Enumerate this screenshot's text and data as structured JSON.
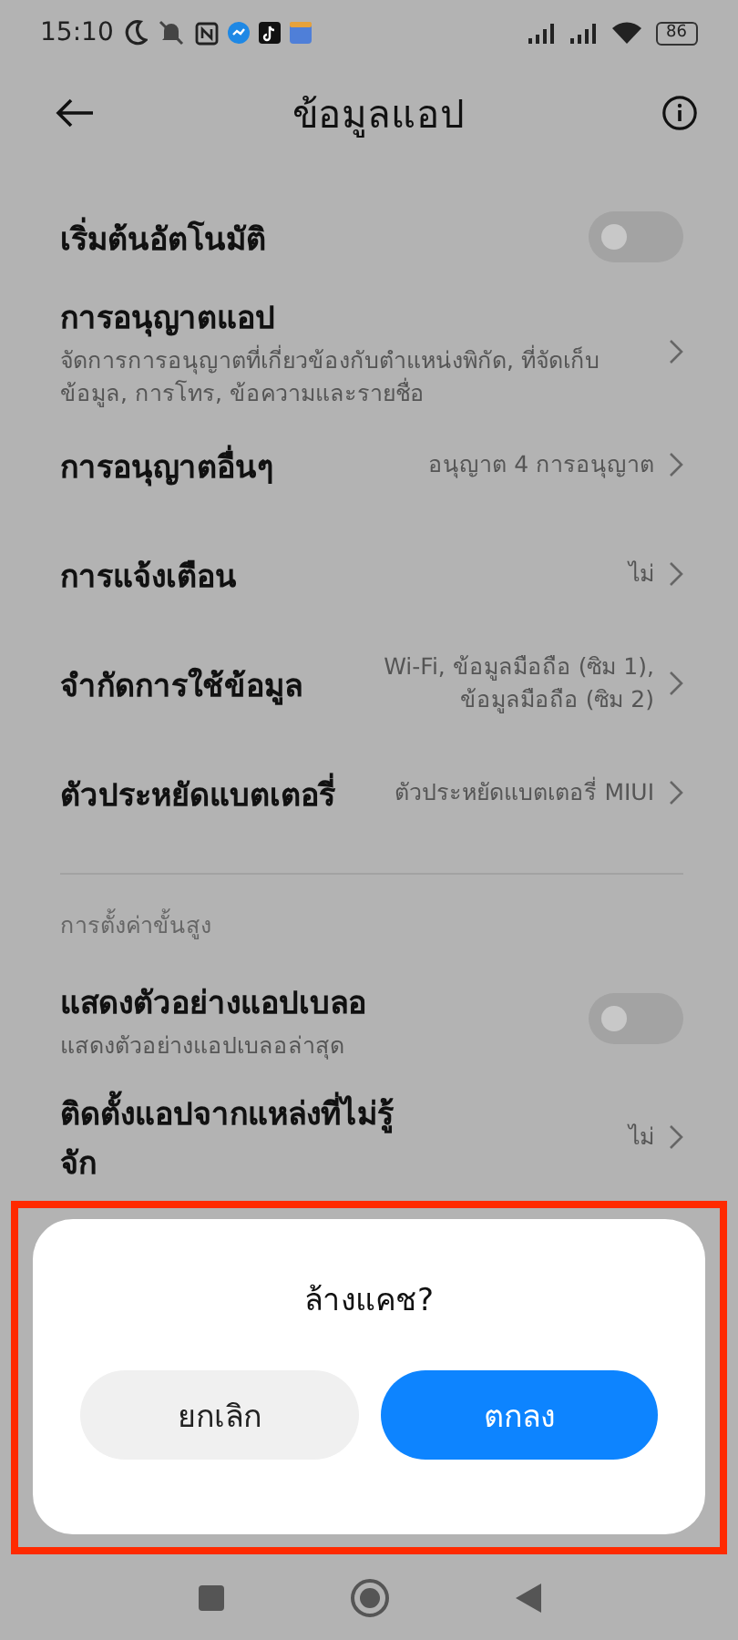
{
  "status_bar": {
    "time": "15:10",
    "battery": "86"
  },
  "header": {
    "title": "ข้อมูลแอป"
  },
  "settings": [
    {
      "kind": "toggle",
      "title": "เริ่มต้นอัตโนมัติ",
      "on": false
    },
    {
      "kind": "link",
      "title": "การอนุญาตแอป",
      "subtitle": "จัดการการอนุญาตที่เกี่ยวข้องกับตำแหน่งพิกัด, ที่จัดเก็บข้อมูล, การโทร, ข้อความและรายชื่อ"
    },
    {
      "kind": "link",
      "title": "การอนุญาตอื่นๆ",
      "value": "อนุญาต 4 การอนุญาต"
    },
    {
      "kind": "link",
      "title": "การแจ้งเตือน",
      "value": "ไม่"
    },
    {
      "kind": "link",
      "title": "จำกัดการใช้ข้อมูล",
      "value": "Wi-Fi, ข้อมูลมือถือ (ซิม 1), ข้อมูลมือถือ (ซิม 2)"
    },
    {
      "kind": "link",
      "title": "ตัวประหยัดแบตเตอรี่",
      "value": "ตัวประหยัดแบตเตอรี่ MIUI"
    }
  ],
  "advanced": {
    "heading": "การตั้งค่าขั้นสูง",
    "rows": [
      {
        "kind": "toggle",
        "title": "แสดงตัวอย่างแอปเบลอ",
        "subtitle": "แสดงตัวอย่างแอปเบลอล่าสุด",
        "on": false
      },
      {
        "kind": "link",
        "title": "ติดตั้งแอปจากแหล่งที่ไม่รู้จัก",
        "value": "ไม่"
      }
    ]
  },
  "dialog": {
    "title": "ล้างแคช?",
    "buttons": [
      {
        "label": "ยกเลิก",
        "kind": "cancel"
      },
      {
        "label": "ตกลง",
        "kind": "confirm"
      }
    ]
  }
}
